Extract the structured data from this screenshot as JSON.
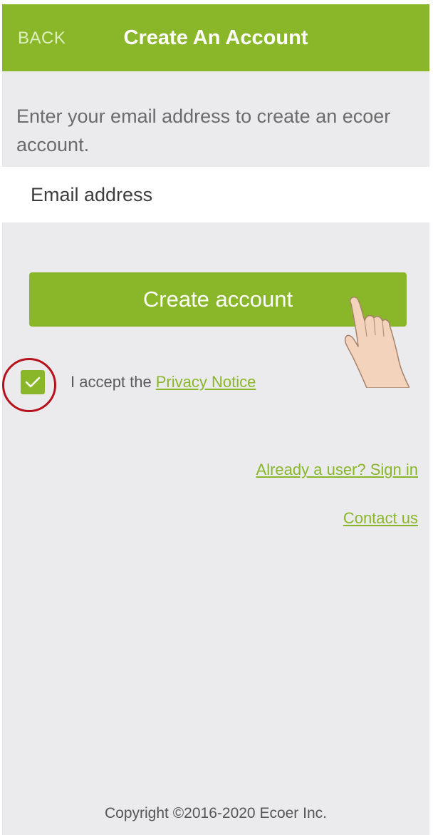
{
  "header": {
    "back_label": "BACK",
    "title": "Create An Account"
  },
  "form": {
    "intro_text": "Enter your email address to create an ecoer account.",
    "email_placeholder": "Email address",
    "email_value": "",
    "submit_label": "Create account"
  },
  "terms": {
    "checked": true,
    "accept_text": "I accept the",
    "privacy_link": "Privacy Notice"
  },
  "links": {
    "signin": "Already a user? Sign in",
    "contact": "Contact us"
  },
  "footer": {
    "copyright": "Copyright ©2016-2020 Ecoer Inc."
  },
  "theme": {
    "accent": "#8ab72a",
    "background": "#ebebed",
    "annotation_ring": "#b5121b"
  },
  "annotations": {
    "pointer_icon": "pointing-hand-icon",
    "ring_icon": "highlight-circle"
  }
}
